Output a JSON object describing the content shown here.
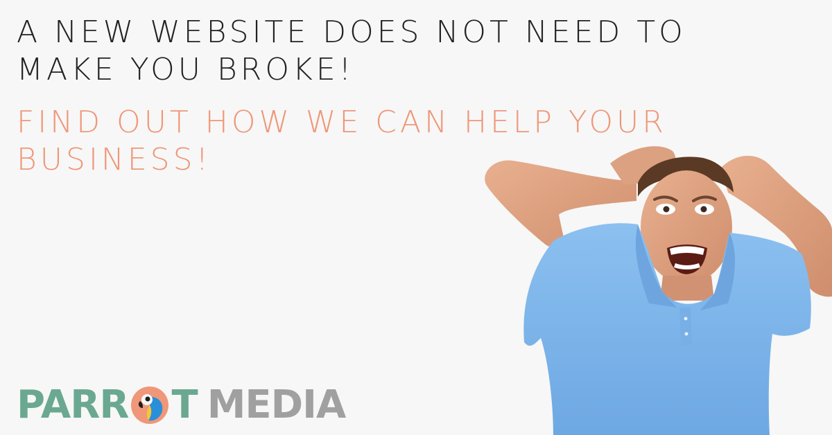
{
  "headline": {
    "text": "A NEW WEBSITE DOES NOT NEED TO MAKE YOU BROKE!"
  },
  "subheadline": {
    "text": "FIND OUT HOW WE CAN HELP YOUR BUSINESS!"
  },
  "logo": {
    "parrot_before_o": "PARR",
    "parrot_after_o": "T",
    "media": "MEDIA",
    "parrot_icon": "parrot-icon"
  },
  "colors": {
    "background": "#f7f7f7",
    "headline_text": "#222222",
    "accent_orange": "#ef9778",
    "brand_teal": "#6ba892",
    "brand_gray": "#a0a0a0",
    "parrot_blue": "#2a8fd9",
    "parrot_yellow": "#f4c63a",
    "shirt_blue": "#7fb6ea"
  }
}
